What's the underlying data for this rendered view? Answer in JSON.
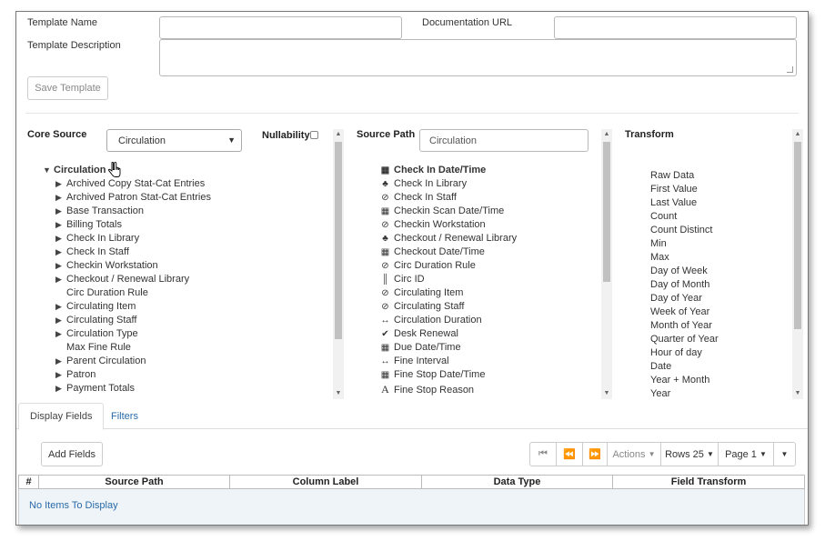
{
  "form": {
    "template_name_label": "Template Name",
    "template_name_value": "",
    "doc_url_label": "Documentation URL",
    "doc_url_value": "",
    "template_desc_label": "Template Description",
    "template_desc_value": "",
    "save_template_label": "Save Template"
  },
  "core_source": {
    "label": "Core Source",
    "selected": "Circulation",
    "nullability_label": "Nullability",
    "nullability_checked": false,
    "tree": {
      "root_label": "Circulation",
      "root_expanded": true,
      "children": [
        {
          "label": "Archived Copy Stat-Cat Entries",
          "expandable": true
        },
        {
          "label": "Archived Patron Stat-Cat Entries",
          "expandable": true
        },
        {
          "label": "Base Transaction",
          "expandable": true
        },
        {
          "label": "Billing Totals",
          "expandable": true
        },
        {
          "label": "Check In Library",
          "expandable": true
        },
        {
          "label": "Check In Staff",
          "expandable": true
        },
        {
          "label": "Checkin Workstation",
          "expandable": true
        },
        {
          "label": "Checkout / Renewal Library",
          "expandable": true
        },
        {
          "label": "Circ Duration Rule",
          "expandable": false
        },
        {
          "label": "Circulating Item",
          "expandable": true
        },
        {
          "label": "Circulating Staff",
          "expandable": true
        },
        {
          "label": "Circulation Type",
          "expandable": true
        },
        {
          "label": "Max Fine Rule",
          "expandable": false
        },
        {
          "label": "Parent Circulation",
          "expandable": true
        },
        {
          "label": "Patron",
          "expandable": true
        },
        {
          "label": "Payment Totals",
          "expandable": true
        }
      ]
    }
  },
  "source_path": {
    "label": "Source Path",
    "value": "Circulation",
    "items": [
      {
        "label": "Check In Date/Time",
        "icon": "calendar-icon",
        "bold": true
      },
      {
        "label": "Check In Library",
        "icon": "tree-icon",
        "bold": false
      },
      {
        "label": "Check In Staff",
        "icon": "link-icon",
        "bold": false
      },
      {
        "label": "Checkin Scan Date/Time",
        "icon": "calendar-icon",
        "bold": false
      },
      {
        "label": "Checkin Workstation",
        "icon": "link-icon",
        "bold": false
      },
      {
        "label": "Checkout / Renewal Library",
        "icon": "tree-icon",
        "bold": false
      },
      {
        "label": "Checkout Date/Time",
        "icon": "calendar-icon",
        "bold": false
      },
      {
        "label": "Circ Duration Rule",
        "icon": "link-icon",
        "bold": false
      },
      {
        "label": "Circ ID",
        "icon": "barcode-icon",
        "bold": false
      },
      {
        "label": "Circulating Item",
        "icon": "link-icon",
        "bold": false
      },
      {
        "label": "Circulating Staff",
        "icon": "link-icon",
        "bold": false
      },
      {
        "label": "Circulation Duration",
        "icon": "arrows-horizontal-icon",
        "bold": false
      },
      {
        "label": "Desk Renewal",
        "icon": "check-circle-icon",
        "bold": false
      },
      {
        "label": "Due Date/Time",
        "icon": "calendar-icon",
        "bold": false
      },
      {
        "label": "Fine Interval",
        "icon": "arrows-horizontal-icon",
        "bold": false
      },
      {
        "label": "Fine Stop Date/Time",
        "icon": "calendar-icon",
        "bold": false
      },
      {
        "label": "Fine Stop Reason",
        "icon": "text-icon",
        "bold": false
      }
    ]
  },
  "transform": {
    "label": "Transform",
    "items": [
      "Raw Data",
      "First Value",
      "Last Value",
      "Count",
      "Count Distinct",
      "Min",
      "Max",
      "Day of Week",
      "Day of Month",
      "Day of Year",
      "Week of Year",
      "Month of Year",
      "Quarter of Year",
      "Hour of day",
      "Date",
      "Year + Month",
      "Year"
    ]
  },
  "tabs": {
    "display_fields": "Display Fields",
    "filters": "Filters"
  },
  "grid": {
    "add_fields_label": "Add Fields",
    "actions_label": "Actions",
    "rows_label": "Rows 25",
    "page_label": "Page 1",
    "columns": [
      "#",
      "Source Path",
      "Column Label",
      "Data Type",
      "Field Transform"
    ],
    "empty_text": "No Items To Display"
  },
  "colors": {
    "link": "#2a6aa8",
    "grid_body_bg": "#eef4f8"
  }
}
